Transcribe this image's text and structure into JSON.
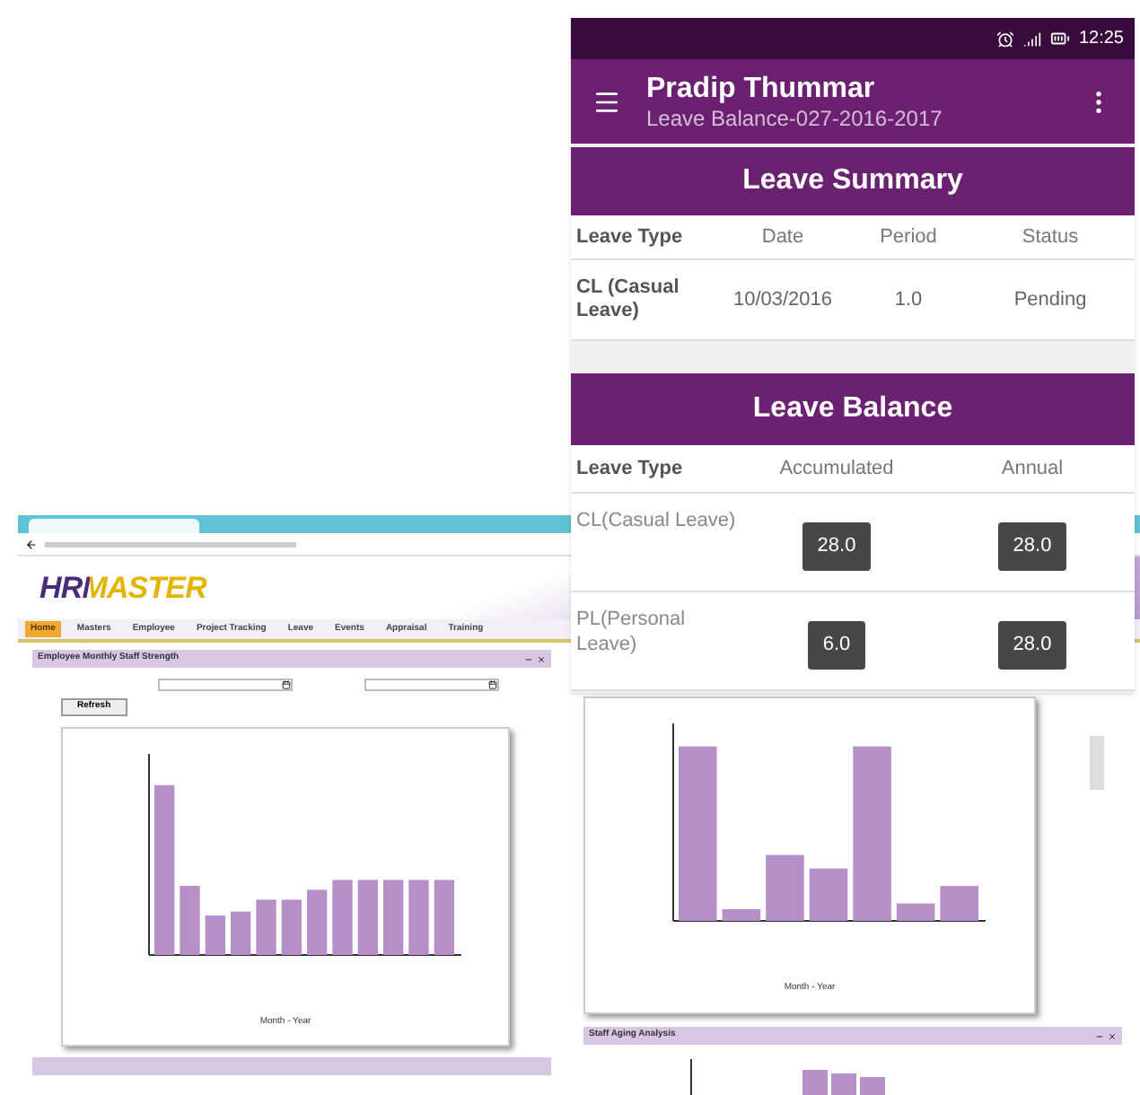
{
  "browser": {
    "logo": "HRMASTER",
    "nav": [
      {
        "label": "Home",
        "selected": true
      },
      {
        "label": "Masters",
        "selected": false
      },
      {
        "label": "Employee",
        "selected": false
      },
      {
        "label": "Project Tracking",
        "selected": false
      },
      {
        "label": "Leave",
        "selected": false
      },
      {
        "label": "Events",
        "selected": false
      },
      {
        "label": "Appraisal",
        "selected": false
      },
      {
        "label": "Training",
        "selected": false
      }
    ],
    "left_panel": {
      "title": "Employee Monthly Staff Strength",
      "button": "Refresh",
      "xlabel": "Month - Year"
    },
    "right_panel": {
      "xlabel": "Month - Year",
      "next_title": "Staff Aging Analysis"
    }
  },
  "phone": {
    "status_bar": {
      "time": "12:25"
    },
    "header": {
      "title": "Pradip Thummar",
      "subtitle": "Leave Balance-027-2016-2017"
    },
    "leave_summary": {
      "title": "Leave Summary",
      "columns": [
        "Leave Type",
        "Date",
        "Period",
        "Status"
      ],
      "rows": [
        [
          "CL (Casual Leave)",
          "10/03/2016",
          "1.0",
          "Pending"
        ]
      ]
    },
    "leave_balance": {
      "title": "Leave Balance",
      "columns": [
        "Leave Type",
        "Accumulated",
        "Annual"
      ],
      "rows": [
        {
          "type": "CL(Casual Leave)",
          "accumulated": "28.0",
          "annual": "28.0"
        },
        {
          "type": "PL(Personal Leave)",
          "accumulated": "6.0",
          "annual": "28.0"
        }
      ]
    }
  }
}
